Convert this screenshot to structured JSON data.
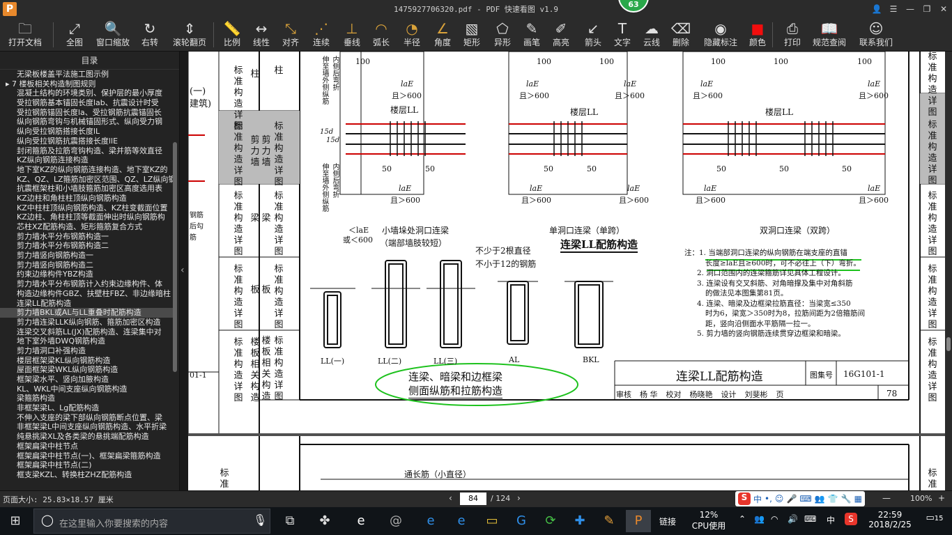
{
  "window": {
    "title": "1475927706320.pdf - PDF 快速看图 v1.9",
    "badge": "63",
    "logo": "P"
  },
  "toolbar": {
    "items": [
      {
        "label": "打开文档",
        "icon": "folder-icon",
        "glyph": "🗀"
      },
      {
        "label": "全图",
        "icon": "fit-all-icon",
        "glyph": "⤢"
      },
      {
        "label": "窗口缩放",
        "icon": "zoom-window-icon",
        "glyph": "🔍"
      },
      {
        "label": "右转",
        "icon": "rotate-right-icon",
        "glyph": "↻"
      },
      {
        "label": "滚轮翻页",
        "icon": "mouse-wheel-icon",
        "glyph": "⇕"
      },
      {
        "label": "比例",
        "icon": "scale-ruler-icon",
        "glyph": "📏"
      },
      {
        "label": "线性",
        "icon": "linear-measure-icon",
        "glyph": "↔"
      },
      {
        "label": "对齐",
        "icon": "aligned-measure-icon",
        "glyph": "⤡"
      },
      {
        "label": "连续",
        "icon": "continuous-measure-icon",
        "glyph": "⋰"
      },
      {
        "label": "垂线",
        "icon": "perpendicular-icon",
        "glyph": "⊥"
      },
      {
        "label": "弧长",
        "icon": "arc-length-icon",
        "glyph": "◠"
      },
      {
        "label": "半径",
        "icon": "radius-icon",
        "glyph": "◔"
      },
      {
        "label": "角度",
        "icon": "angle-icon",
        "glyph": "∠"
      },
      {
        "label": "矩形",
        "icon": "rectangle-area-icon",
        "glyph": "▧"
      },
      {
        "label": "异形",
        "icon": "polygon-area-icon",
        "glyph": "⬠"
      },
      {
        "label": "画笔",
        "icon": "pen-icon",
        "glyph": "✎"
      },
      {
        "label": "高亮",
        "icon": "highlighter-icon",
        "glyph": "✐"
      },
      {
        "label": "箭头",
        "icon": "arrow-icon",
        "glyph": "↙"
      },
      {
        "label": "文字",
        "icon": "text-icon",
        "glyph": "T"
      },
      {
        "label": "云线",
        "icon": "cloud-line-icon",
        "glyph": "☁"
      },
      {
        "label": "删除",
        "icon": "eraser-icon",
        "glyph": "⌫"
      },
      {
        "label": "隐藏标注",
        "icon": "hide-annotation-icon",
        "glyph": "◉"
      },
      {
        "label": "颜色",
        "icon": "color-swatch-icon",
        "glyph": "■"
      },
      {
        "label": "打印",
        "icon": "printer-icon",
        "glyph": "⎙"
      },
      {
        "label": "规范查阅",
        "icon": "book-icon",
        "glyph": "📖"
      },
      {
        "label": "联系我们",
        "icon": "contact-icon",
        "glyph": "☺"
      }
    ]
  },
  "sidebar": {
    "title": "目录",
    "items": [
      "无梁板楼盖平法施工图示例",
      "7 楼板相关构造制图规则",
      "混凝土结构的环境类别、保护层的最小厚度",
      "受拉钢筋基本锚固长度lab、抗震设计时受",
      "受拉钢筋锚固长度la、受拉钢筋抗震锚固长",
      "纵向钢筋弯钩与机械锚固形式、纵向受力钢",
      "纵向受拉钢筋搭接长度lL",
      "纵向受拉钢筋抗震搭接长度llE",
      "封闭箍筋及拉筋弯钩构造、梁并筋等效直径",
      "KZ纵向钢筋连接构造",
      "地下室KZ的纵向钢筋连接构造、地下室KZ的",
      "KZ、QZ、LZ箍筋加密区范围、QZ、LZ纵向钢",
      "抗震框架柱和小墙肢箍筋加密区高度选用表",
      "KZ边柱和角柱柱顶纵向钢筋构造",
      "KZ中柱柱顶纵向钢筋构造、KZ柱变截面位置",
      "KZ边柱、角柱柱顶等截面伸出时纵向钢筋构",
      "芯柱XZ配筋构造、矩形箍筋复合方式",
      "剪力墙水平分布钢筋构造一",
      "剪力墙水平分布钢筋构造二",
      "剪力墙竖向钢筋构造一",
      "剪力墙竖向钢筋构造二",
      "约束边缘构件YBZ构造",
      "剪力墙水平分布钢筋计入约束边缘构件、体",
      "构造边缘构件GBZ、扶壁柱FBZ、非边缘暗柱",
      "连梁LL配筋构造",
      "剪力墙BKL或AL与LL重叠时配筋构造",
      "剪力墙连梁LLK纵向钢筋、箍筋加密区构造",
      "连梁交叉斜筋LL(JX)配筋构造、连梁集中对",
      "地下室外墙DWQ钢筋构造",
      "剪力墙洞口补强构造",
      "楼层框架梁KL纵向钢筋构造",
      "屋面框架梁WKL纵向钢筋构造",
      "框架梁水平、竖向加腋构造",
      "KL、WKL中间支座纵向钢筋构造",
      "梁箍筋构造",
      "非框架梁L、Lg配筋构造",
      "不伸入支座的梁下部纵向钢筋断点位置、梁",
      "非框架梁L中间支座纵向钢筋构造、水平折梁",
      "纯悬挑梁XL及各类梁的悬挑端配筋构造",
      "框架扁梁中柱节点",
      "框架扁梁中柱节点(一)、框架扁梁箍筋构造",
      "框架扁梁中柱节点(二)",
      "框支梁KZL、转换柱ZHZ配筋构造"
    ]
  },
  "drawing": {
    "left_cats": [
      "柱",
      "剪力墙",
      "梁",
      "板",
      "楼板相关构造"
    ],
    "left_col": "标准构造详图",
    "left_labels": [
      "柱",
      "剪力墙",
      "梁",
      "板",
      "楼板相关构造"
    ],
    "top_notes": [
      "伸至墙外侧纵筋",
      "内侧后弯折",
      "伸至墙外侧纵筋",
      "内侧后弯折"
    ],
    "dims": {
      "d100": "100",
      "d50": "50",
      "d15d": "15d",
      "lae": "laE",
      "ge600": "且＞600",
      "lt_lae": "＜laE",
      "or600": "或＜600"
    },
    "beam_label": "楼层LL",
    "cap1a": "小墙垛处洞口连梁",
    "cap1b": "（端部墙肢较短）",
    "cap2": "单洞口连梁（单跨）",
    "cap3": "双洞口连梁（双跨）",
    "heading": "连梁LL配筋构造",
    "sections": [
      "LL(一)",
      "LL(二)",
      "LL(三)",
      "AL",
      "BKL"
    ],
    "sec_note1": "不少于2根直径",
    "sec_note2": "不小于12的钢筋",
    "circle_title_1": "连梁、暗梁和边框梁",
    "circle_title_2": "侧面纵筋和拉筋构造",
    "notes": [
      "注：1. 当端部洞口连梁的纵向钢筋在端支座的直锚",
      "长度≥laE且≥600时，可不必往上（下）弯折。",
      "2. 洞口范围内的连梁箍筋详见具体工程设计。",
      "3. 连梁设有交叉斜筋、对角暗撑及集中对角斜筋",
      "的做法见本图集第81页。",
      "4. 连梁、暗梁及边框梁拉筋直径：当梁宽≤350",
      "时为6，梁宽＞350时为8，拉筋间距为2倍箍筋间",
      "距，竖向沿侧面水平筋隔一拉一。",
      "5. 剪力墙的竖向钢筋连续贯穿边框梁和暗梁。"
    ],
    "tb_title": "连梁LL配筋构造",
    "tb_atlas_lbl": "图集号",
    "tb_atlas": "16G101-1",
    "tb_row": [
      "审核",
      "杨  华",
      "校对",
      "杨晓艳",
      "设计",
      "刘斐彬",
      "页"
    ],
    "tb_page": "78",
    "side_code": "01-1",
    "left_frag": [
      "(一)",
      "建筑)"
    ],
    "steel_lbl": [
      "钢筋",
      "后勾",
      "筋"
    ],
    "p2_label": "通长筋（小直径）",
    "p2_cat": "标准",
    "right_cats": [
      "标准构造详图",
      "标准构造详图",
      "标准构造详图",
      "标准构造详图",
      "标准构造详图"
    ]
  },
  "status": {
    "page_size": "页面大小: 25.83×18.57 厘米",
    "page_current": "84",
    "page_total": "/ 124",
    "zoom": "100%"
  },
  "taskbar": {
    "search_placeholder": "在这里输入你要搜索的内容",
    "cpu_pct": "12%",
    "cpu_label": "CPU使用",
    "link": "链接",
    "ime": "中",
    "time": "22:59",
    "date": "2018/2/25",
    "notif": "15",
    "apps": [
      {
        "icon": "task-view-icon",
        "glyph": "⧉"
      },
      {
        "icon": "pinwheel-icon",
        "glyph": "✤"
      },
      {
        "icon": "edge-legacy-icon",
        "glyph": "e"
      },
      {
        "icon": "spiral-browser-icon",
        "glyph": "@"
      },
      {
        "icon": "edge-icon",
        "glyph": "e"
      },
      {
        "icon": "ie-icon",
        "glyph": "e"
      },
      {
        "icon": "file-explorer-icon",
        "glyph": "▭"
      },
      {
        "icon": "g-app-icon",
        "glyph": "G"
      },
      {
        "icon": "green-sync-icon",
        "glyph": "⟳"
      },
      {
        "icon": "blue-plus-icon",
        "glyph": "✚"
      },
      {
        "icon": "notepad-icon",
        "glyph": "✎"
      },
      {
        "icon": "pdf-viewer-icon",
        "glyph": "P"
      }
    ]
  }
}
